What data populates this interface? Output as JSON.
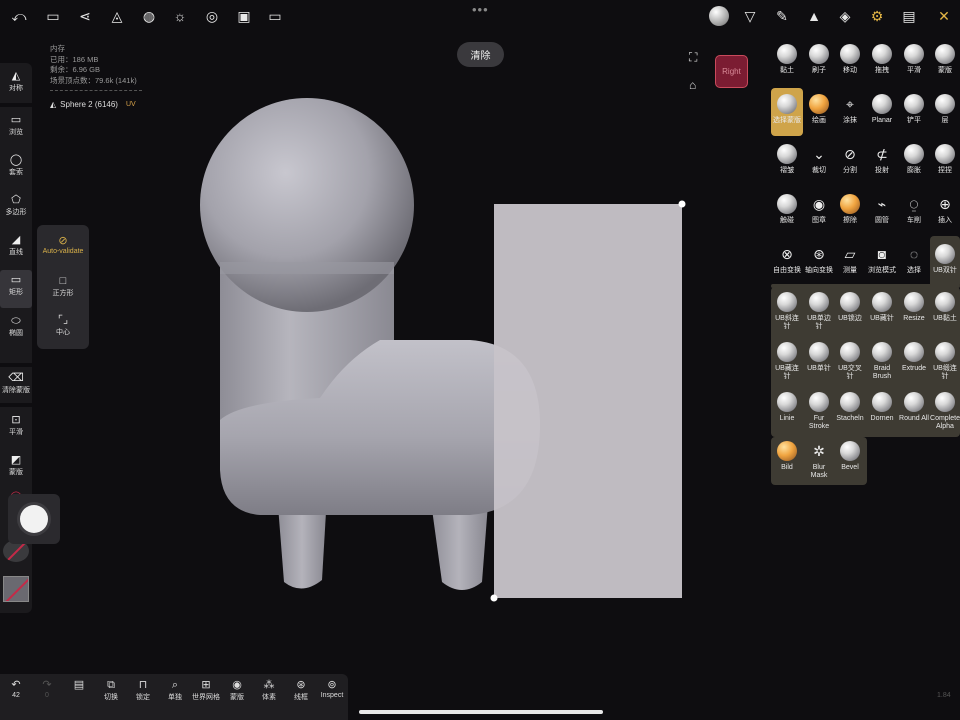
{
  "memory": {
    "title": "内存",
    "used": "已用：186 MB",
    "remaining": "剩余：6.96 GB",
    "vertices": "场景顶点数：79.6k (141k)"
  },
  "layer": {
    "name": "Sphere 2 (6146)",
    "uv": "UV"
  },
  "clear_button": "清除",
  "view_cube_label": "Right",
  "left_toolbar": [
    {
      "label": "对称",
      "icon": "symmetry-icon"
    },
    {
      "label": "浏览",
      "icon": "camera-icon"
    },
    {
      "label": "套索",
      "icon": "lasso-icon"
    },
    {
      "label": "多边形",
      "icon": "polygon-icon"
    },
    {
      "label": "直线",
      "icon": "line-icon"
    },
    {
      "label": "矩形",
      "icon": "rectangle-icon"
    },
    {
      "label": "椭圆",
      "icon": "ellipse-icon"
    },
    {
      "label": "清除蒙版",
      "icon": "eraser-icon"
    },
    {
      "label": "平滑",
      "icon": "smooth-icon"
    },
    {
      "label": "蒙版",
      "icon": "mask-icon"
    },
    {
      "label": "除",
      "icon": "partial-icon"
    }
  ],
  "flyout": [
    {
      "label": "Auto-validate",
      "icon": "check-circle-icon"
    },
    {
      "label": "正方形",
      "icon": "square-icon"
    },
    {
      "label": "中心",
      "icon": "center-icon"
    }
  ],
  "brushes": [
    {
      "label": "黏土"
    },
    {
      "label": "刷子"
    },
    {
      "label": "移动"
    },
    {
      "label": "拖拽"
    },
    {
      "label": "平滑"
    },
    {
      "label": "蒙版"
    },
    {
      "label": "选择蒙版"
    },
    {
      "label": "绘画"
    },
    {
      "label": "涂抹"
    },
    {
      "label": "Planar"
    },
    {
      "label": "铲平"
    },
    {
      "label": "层"
    },
    {
      "label": "褶皱"
    },
    {
      "label": "裁切"
    },
    {
      "label": "分割"
    },
    {
      "label": "投射"
    },
    {
      "label": "膨胀"
    },
    {
      "label": "捏捏"
    },
    {
      "label": "触碰"
    },
    {
      "label": "图章"
    },
    {
      "label": "擦除"
    },
    {
      "label": "圆管"
    },
    {
      "label": "车削"
    },
    {
      "label": "插入"
    },
    {
      "label": "自由变换"
    },
    {
      "label": "轴向变换"
    },
    {
      "label": "测量"
    },
    {
      "label": "浏览模式"
    },
    {
      "label": "选择"
    },
    {
      "label": "UB双针"
    },
    {
      "label": "UB斜连针"
    },
    {
      "label": "UB单边针"
    },
    {
      "label": "UB锁边"
    },
    {
      "label": "UB藏针"
    },
    {
      "label": "Resize"
    },
    {
      "label": "UB黏土"
    },
    {
      "label": "UB藏连针"
    },
    {
      "label": "UB单针"
    },
    {
      "label": "UB交叉针"
    },
    {
      "label": "Braid Brush"
    },
    {
      "label": "Extrude"
    },
    {
      "label": "UB缎连针"
    },
    {
      "label": "Linie"
    },
    {
      "label": "Fur Stroke"
    },
    {
      "label": "Stacheln"
    },
    {
      "label": "Dornen"
    },
    {
      "label": "Round All"
    },
    {
      "label": "Complete Alpha"
    },
    {
      "label": "Bild"
    },
    {
      "label": "Blur Mask"
    },
    {
      "label": "Bevel"
    }
  ],
  "bottom_bar": [
    {
      "label": "42",
      "icon": "undo-icon"
    },
    {
      "label": "0",
      "icon": "redo-icon"
    },
    {
      "label": "",
      "icon": "layers-icon"
    },
    {
      "label": "切换",
      "icon": "switch-icon"
    },
    {
      "label": "锁定",
      "icon": "lock-icon"
    },
    {
      "label": "单独",
      "icon": "solo-icon"
    },
    {
      "label": "世界网格",
      "icon": "grid-icon"
    },
    {
      "label": "蒙版",
      "icon": "eye-icon"
    },
    {
      "label": "体素",
      "icon": "voxel-icon"
    },
    {
      "label": "线框",
      "icon": "wireframe-icon"
    },
    {
      "label": "Inspect",
      "icon": "inspect-icon"
    }
  ],
  "version": "1.84",
  "colors": {
    "background": "#0e0d10",
    "accent": "#e3b545",
    "model": "#a8a7ae",
    "selection_rect": "#c7c3c9"
  }
}
